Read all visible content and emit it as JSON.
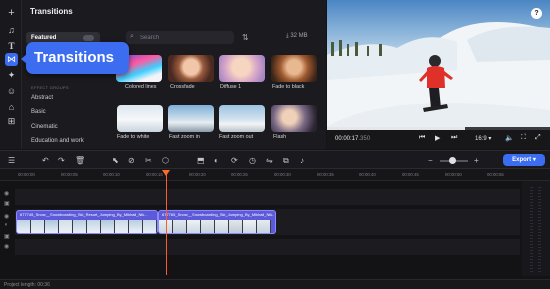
{
  "panel": {
    "title": "Transitions",
    "search_placeholder": "Search",
    "storage": "32 MB",
    "section_header": "EFFECT GROUPS",
    "categories": [
      "Featured",
      "Abstract",
      "Basic",
      "Cinematic",
      "Education and work"
    ],
    "tooltip": "Transitions",
    "thumbnails": [
      {
        "label": "Colored lines"
      },
      {
        "label": "Crossfade"
      },
      {
        "label": "Diffuse 1"
      },
      {
        "label": "Fade to black"
      },
      {
        "label": "Fade to white"
      },
      {
        "label": "Fast zoom in"
      },
      {
        "label": "Fast zoom out"
      },
      {
        "label": "Flash"
      }
    ]
  },
  "player": {
    "current_time": "00:00:17",
    "current_frac": ".350",
    "aspect": "16:9",
    "progress": 0.62,
    "help_label": "?"
  },
  "toolbar": {
    "export_label": "Export"
  },
  "ruler": {
    "ticks": [
      "00:00:00",
      "00:00:05",
      "00:00:10",
      "00:00:15",
      "00:00:20",
      "00:00:25",
      "00:00:30",
      "00:00:35",
      "00:00:40",
      "00:00:45",
      "00:00:50",
      "00:00:55"
    ]
  },
  "timeline": {
    "clips": [
      {
        "name": "677745_Snow__Snowboarding_Ski_Resort_Jumping_By_Mikhail_Nik..."
      },
      {
        "name": "677765_Snow__Snowboarding_Ski_Jumping_By_Mikhail_Nik..."
      }
    ]
  },
  "footer": {
    "project_length": "Project length: 00:36"
  },
  "colors": {
    "accent": "#3c6df0",
    "playhead": "#ff5a2a",
    "clip": "#5c5ad8"
  },
  "icons": [
    "add-icon",
    "music-icon",
    "text-icon",
    "transitions-icon",
    "filters-icon",
    "stickers-icon",
    "elements-icon",
    "more-icon",
    "search-icon",
    "filter-icon",
    "download-icon",
    "help-icon"
  ]
}
